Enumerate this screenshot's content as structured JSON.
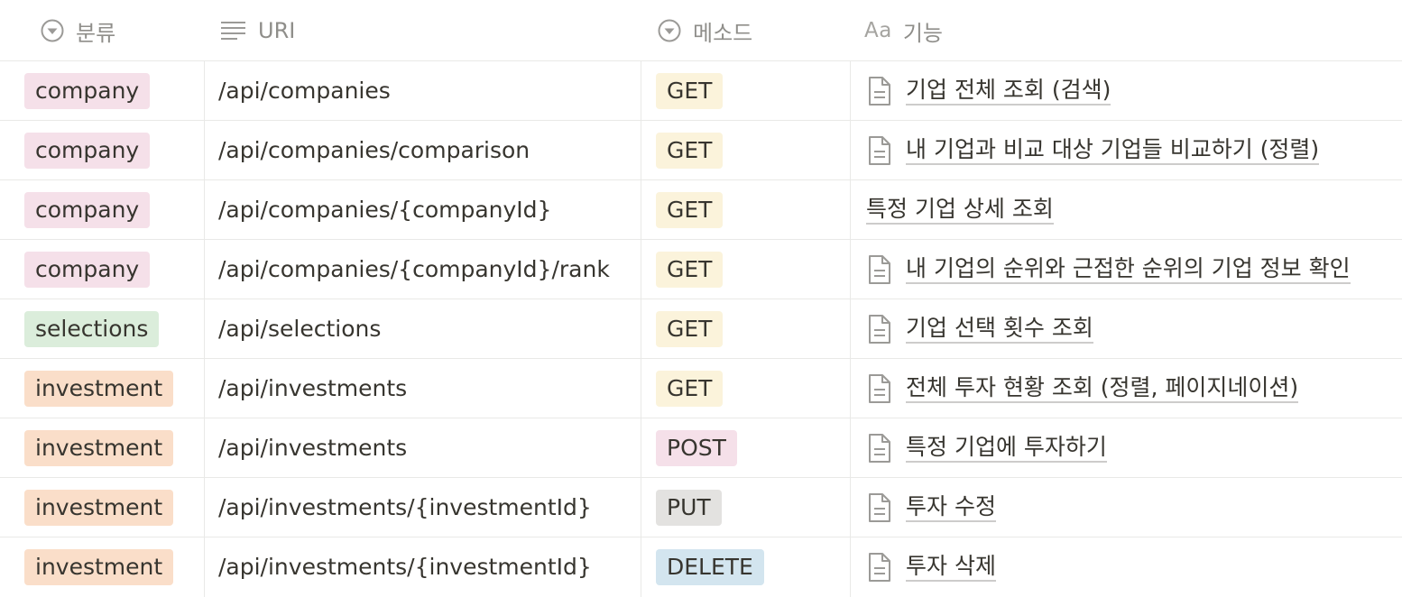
{
  "columns": {
    "category": "분류",
    "uri": "URI",
    "method": "메소드",
    "function_prefix": "Aa",
    "function": "기능"
  },
  "rows": [
    {
      "category": "company",
      "uri": "/api/companies",
      "method": "GET",
      "function": "기업 전체 조회 (검색)",
      "has_doc": true
    },
    {
      "category": "company",
      "uri": "/api/companies/comparison",
      "method": "GET",
      "function": "내 기업과 비교 대상 기업들 비교하기 (정렬)",
      "has_doc": true
    },
    {
      "category": "company",
      "uri": "/api/companies/{companyId}",
      "method": "GET",
      "function": "특정 기업 상세 조회",
      "has_doc": false
    },
    {
      "category": "company",
      "uri": "/api/companies/{companyId}/rank",
      "method": "GET",
      "function": "내 기업의 순위와 근접한 순위의 기업 정보 확인",
      "has_doc": true
    },
    {
      "category": "selections",
      "uri": "/api/selections",
      "method": "GET",
      "function": "기업 선택 횟수 조회",
      "has_doc": true
    },
    {
      "category": "investment",
      "uri": "/api/investments",
      "method": "GET",
      "function": "전체 투자 현황 조회 (정렬, 페이지네이션)",
      "has_doc": true
    },
    {
      "category": "investment",
      "uri": "/api/investments",
      "method": "POST",
      "function": "특정 기업에 투자하기",
      "has_doc": true
    },
    {
      "category": "investment",
      "uri": "/api/investments/{investmentId}",
      "method": "PUT",
      "function": "투자 수정",
      "has_doc": true
    },
    {
      "category": "investment",
      "uri": "/api/investments/{investmentId}",
      "method": "DELETE",
      "function": "투자 삭제",
      "has_doc": true
    }
  ],
  "tag_colors": {
    "company": "#f5e0e9",
    "selections": "#dbeddb",
    "investment": "#fadec9",
    "GET": "#fbf3db",
    "POST": "#f5e0e9",
    "PUT": "#e3e2e0",
    "DELETE": "#d3e5ef"
  },
  "icons": {
    "category": "select-icon",
    "uri": "text-lines-icon",
    "method": "select-icon",
    "doc": "page-icon"
  }
}
